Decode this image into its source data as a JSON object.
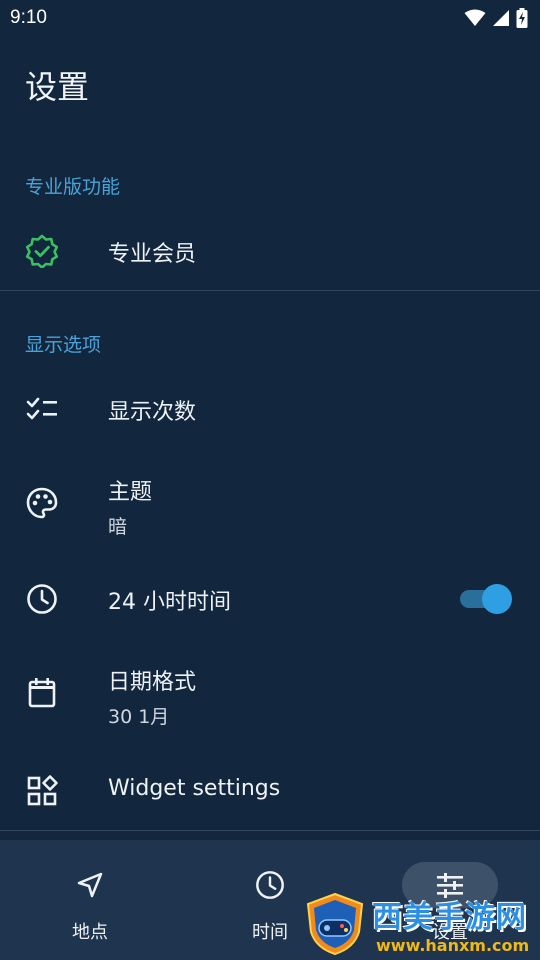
{
  "status_bar": {
    "time": "9:10"
  },
  "page": {
    "title": "设置"
  },
  "sections": {
    "pro": {
      "header": "专业版功能",
      "items": [
        {
          "title": "专业会员",
          "icon": "verified-badge-icon"
        }
      ]
    },
    "display": {
      "header": "显示选项",
      "items": [
        {
          "title": "显示次数",
          "icon": "checklist-icon"
        },
        {
          "title": "主题",
          "subtitle": "暗",
          "icon": "palette-icon"
        },
        {
          "title": "24 小时时间",
          "icon": "clock-icon",
          "toggle_on": true
        },
        {
          "title": "日期格式",
          "subtitle": "30 1月",
          "icon": "calendar-icon"
        },
        {
          "title": "Widget settings",
          "icon": "widgets-icon"
        }
      ]
    }
  },
  "bottom_nav": {
    "items": [
      {
        "label": "地点",
        "icon": "navigation-arrow-icon"
      },
      {
        "label": "时间",
        "icon": "clock-icon"
      },
      {
        "label": "设置",
        "icon": "sliders-icon",
        "active": true
      }
    ]
  },
  "watermark": {
    "text": "西美手游网",
    "url": "www.hanxm.com"
  },
  "colors": {
    "background": "#12263e",
    "accent": "#4aa3d6",
    "toggle": "#2f9fe3",
    "pro_badge": "#3ac060",
    "nav_background": "#1f344f"
  }
}
